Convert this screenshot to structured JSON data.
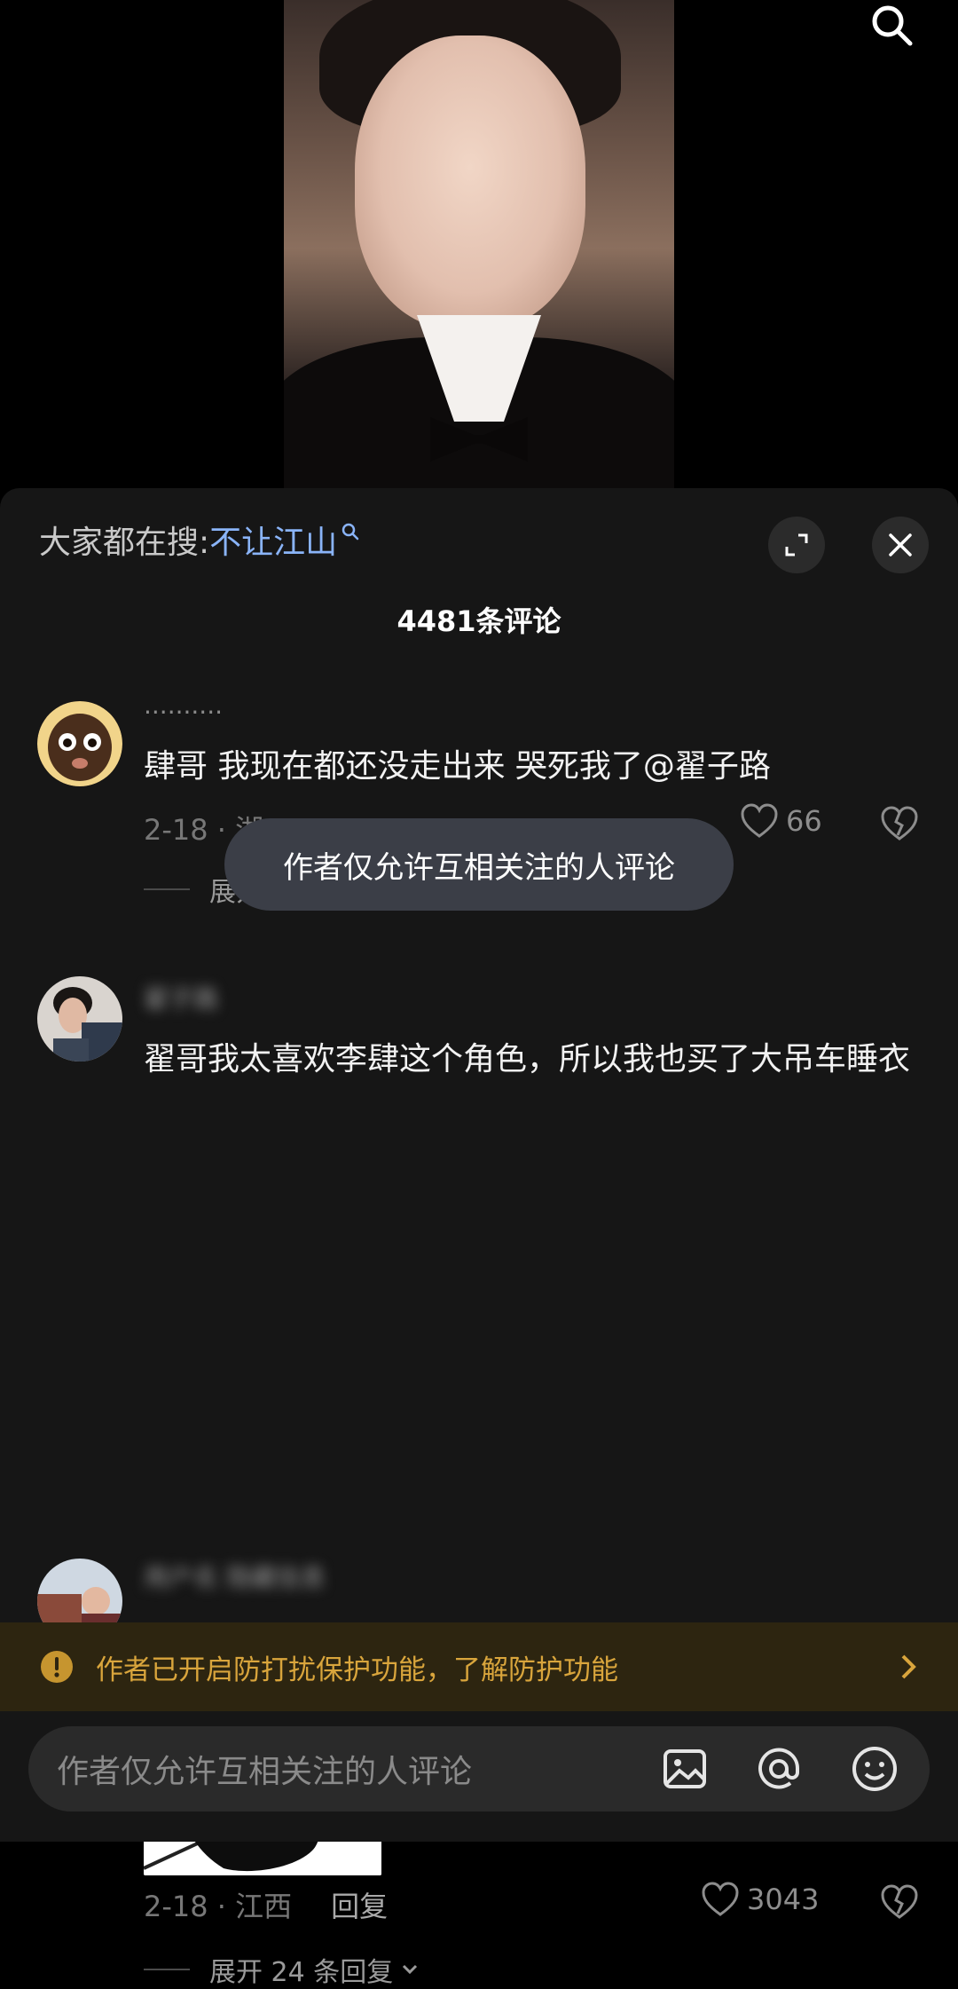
{
  "hot_search": {
    "prefix": "大家都在搜:",
    "keyword": "不让江山"
  },
  "comments_header": {
    "title": "4481条评论"
  },
  "comments": [
    {
      "username": "··········",
      "text": "肆哥 我现在都还没走出来  哭死我了@翟子路",
      "date_location": "2-18 · 湖",
      "likes": "66",
      "expand_label": "展开"
    },
    {
      "username": "翟子路",
      "text": "翟哥我太喜欢李肆这个角色，所以我也买了大吊车睡衣",
      "date_location": "2-18 · 江西",
      "reply_label": "回复",
      "likes": "3043",
      "expand_label": "展开 24 条回复"
    },
    {
      "username": "用户名 隐藏信息"
    }
  ],
  "toast": {
    "message": "作者仅允许互相关注的人评论"
  },
  "warning_bar": {
    "text": "作者已开启防打扰保护功能，了解防护功能"
  },
  "input_bar": {
    "placeholder": "作者仅允许互相关注的人评论"
  },
  "icons": {
    "search": "search-icon",
    "expand": "expand-icon",
    "close": "close-icon",
    "like": "heart-icon",
    "dislike": "broken-heart-icon",
    "warning": "warning-icon",
    "image": "image-icon",
    "mention": "at-icon",
    "emoji": "emoji-icon"
  },
  "colors": {
    "accent_link": "#8ab4f8",
    "warning_text": "#d9a53c",
    "warning_bg": "#2d2510",
    "sheet_bg": "#161616"
  }
}
